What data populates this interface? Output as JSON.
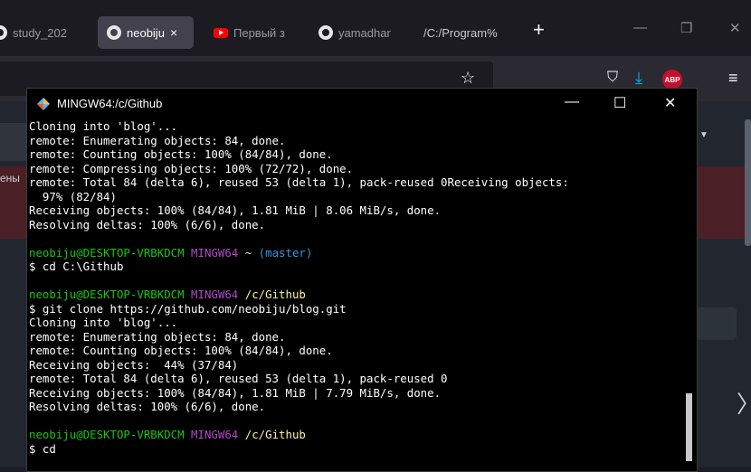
{
  "browser": {
    "tabs": [
      {
        "label": "study_202",
        "icon": "github-icon",
        "active": false
      },
      {
        "label": "neobiju",
        "icon": "github-icon",
        "active": true
      },
      {
        "label": "Первый з",
        "icon": "youtube-icon",
        "active": false
      },
      {
        "label": "yamadhar",
        "icon": "github-icon",
        "active": false
      },
      {
        "label": "/C:/Program%",
        "icon": "",
        "active": false
      }
    ],
    "tab_close_glyph": "×",
    "new_tab_glyph": "+",
    "window_controls": {
      "minimize": "—",
      "restore": "❐",
      "close": "✕"
    },
    "toolbar": {
      "bookmark_star": "☆",
      "pocket": "⛉",
      "download": "⤓",
      "abp_label": "ABP",
      "menu": "≡"
    }
  },
  "page": {
    "side_text": "ены",
    "right_chevron": "〉",
    "caret": "▼"
  },
  "terminal": {
    "title": "MINGW64:/c/Github",
    "controls": {
      "minimize": "—",
      "maximize": "☐",
      "close": "✕"
    },
    "lines": [
      [
        {
          "t": "Cloning into 'blog'..."
        }
      ],
      [
        {
          "t": "remote: Enumerating objects: 84, done."
        }
      ],
      [
        {
          "t": "remote: Counting objects: 100% (84/84), done."
        }
      ],
      [
        {
          "t": "remote: Compressing objects: 100% (72/72), done."
        }
      ],
      [
        {
          "t": "remote: Total 84 (delta 6), reused 53 (delta 1), pack-reused 0Receiving objects:"
        }
      ],
      [
        {
          "t": "  97% (82/84)"
        }
      ],
      [
        {
          "t": "Receiving objects: 100% (84/84), 1.81 MiB | 8.06 MiB/s, done."
        }
      ],
      [
        {
          "t": "Resolving deltas: 100% (6/6), done."
        }
      ],
      [
        {
          "t": ""
        }
      ],
      [
        {
          "t": "neobiju@DESKTOP-VRBKDCM ",
          "c": "green"
        },
        {
          "t": "MINGW64 ",
          "c": "purple"
        },
        {
          "t": "~ ",
          "c": "yellow"
        },
        {
          "t": "(master)",
          "c": "cyan"
        }
      ],
      [
        {
          "t": "$ cd C:\\Github"
        }
      ],
      [
        {
          "t": ""
        }
      ],
      [
        {
          "t": "neobiju@DESKTOP-VRBKDCM ",
          "c": "green"
        },
        {
          "t": "MINGW64 ",
          "c": "purple"
        },
        {
          "t": "/c/Github",
          "c": "yellow"
        }
      ],
      [
        {
          "t": "$ git clone https://github.com/neobiju/blog.git"
        }
      ],
      [
        {
          "t": "Cloning into 'blog'..."
        }
      ],
      [
        {
          "t": "remote: Enumerating objects: 84, done."
        }
      ],
      [
        {
          "t": "remote: Counting objects: 100% (84/84), done."
        }
      ],
      [
        {
          "t": "Receiving objects:  44% (37/84)"
        }
      ],
      [
        {
          "t": "remote: Total 84 (delta 6), reused 53 (delta 1), pack-reused 0"
        }
      ],
      [
        {
          "t": "Receiving objects: 100% (84/84), 1.81 MiB | 7.79 MiB/s, done."
        }
      ],
      [
        {
          "t": "Resolving deltas: 100% (6/6), done."
        }
      ],
      [
        {
          "t": ""
        }
      ],
      [
        {
          "t": "neobiju@DESKTOP-VRBKDCM ",
          "c": "green"
        },
        {
          "t": "MINGW64 ",
          "c": "purple"
        },
        {
          "t": "/c/Github",
          "c": "yellow"
        }
      ],
      [
        {
          "t": "$ cd"
        }
      ]
    ]
  }
}
